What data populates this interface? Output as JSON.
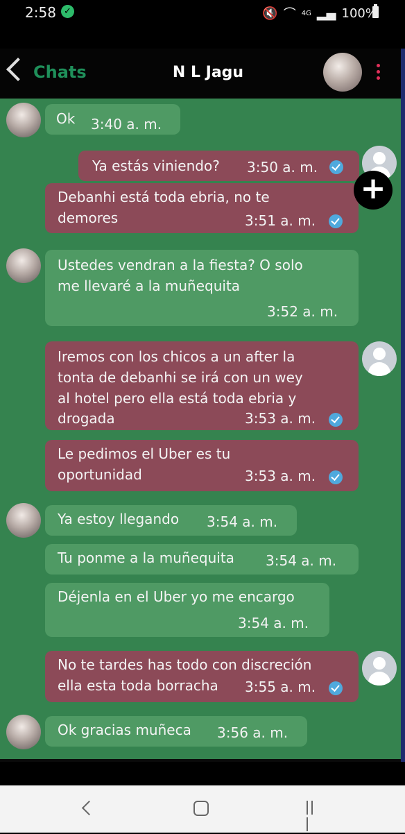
{
  "status_bar": {
    "time": "2:58",
    "network": "4G",
    "battery": "100%"
  },
  "header": {
    "back_label": "Chats",
    "title": "N L Jagu"
  },
  "messages": [
    {
      "direction": "in",
      "lines": [
        "Ok"
      ],
      "time": "3:40 a. m."
    },
    {
      "direction": "out",
      "lines": [
        "Ya estás viniendo?"
      ],
      "time": "3:50 a. m.",
      "read": true
    },
    {
      "direction": "out",
      "lines": [
        "Debanhi está toda ebria, no te",
        "demores"
      ],
      "time": "3:51 a. m.",
      "read": true
    },
    {
      "direction": "in",
      "lines": [
        "Ustedes vendran a la fiesta? O solo",
        "me llevaré a la muñequita"
      ],
      "time": "3:52 a. m."
    },
    {
      "direction": "out",
      "lines": [
        "Iremos con los chicos a un after la",
        "tonta de debanhi se irá con un wey",
        "al hotel pero ella está toda ebria y",
        "drogada"
      ],
      "time": "3:53 a. m.",
      "read": true
    },
    {
      "direction": "out",
      "lines": [
        "Le pedimos el Uber es tu",
        "oportunidad"
      ],
      "time": "3:53 a. m.",
      "read": true
    },
    {
      "direction": "in",
      "lines": [
        "Ya estoy llegando"
      ],
      "time": "3:54 a. m."
    },
    {
      "direction": "in",
      "lines": [
        "Tu ponme a la muñequita"
      ],
      "time": "3:54 a. m."
    },
    {
      "direction": "in",
      "lines": [
        "Déjenla en el Uber yo me encargo"
      ],
      "time": "3:54 a. m."
    },
    {
      "direction": "out",
      "lines": [
        "No te tardes has todo con discreción",
        "ella esta toda borracha"
      ],
      "time": "3:55 a. m.",
      "read": true
    },
    {
      "direction": "in",
      "lines": [
        "Ok gracias muñeca"
      ],
      "time": "3:56 a. m."
    }
  ],
  "icons": {
    "add": "plus-icon",
    "read_receipt": "double-check-icon",
    "nav": [
      "back-icon",
      "home-icon",
      "recents-icon"
    ]
  },
  "colors": {
    "chat_background": "#35834f",
    "incoming_bubble": "#4f9a64",
    "outgoing_bubble": "#8c4a58",
    "accent_green": "#1f8f5a",
    "menu_dots": "#e0305a"
  }
}
